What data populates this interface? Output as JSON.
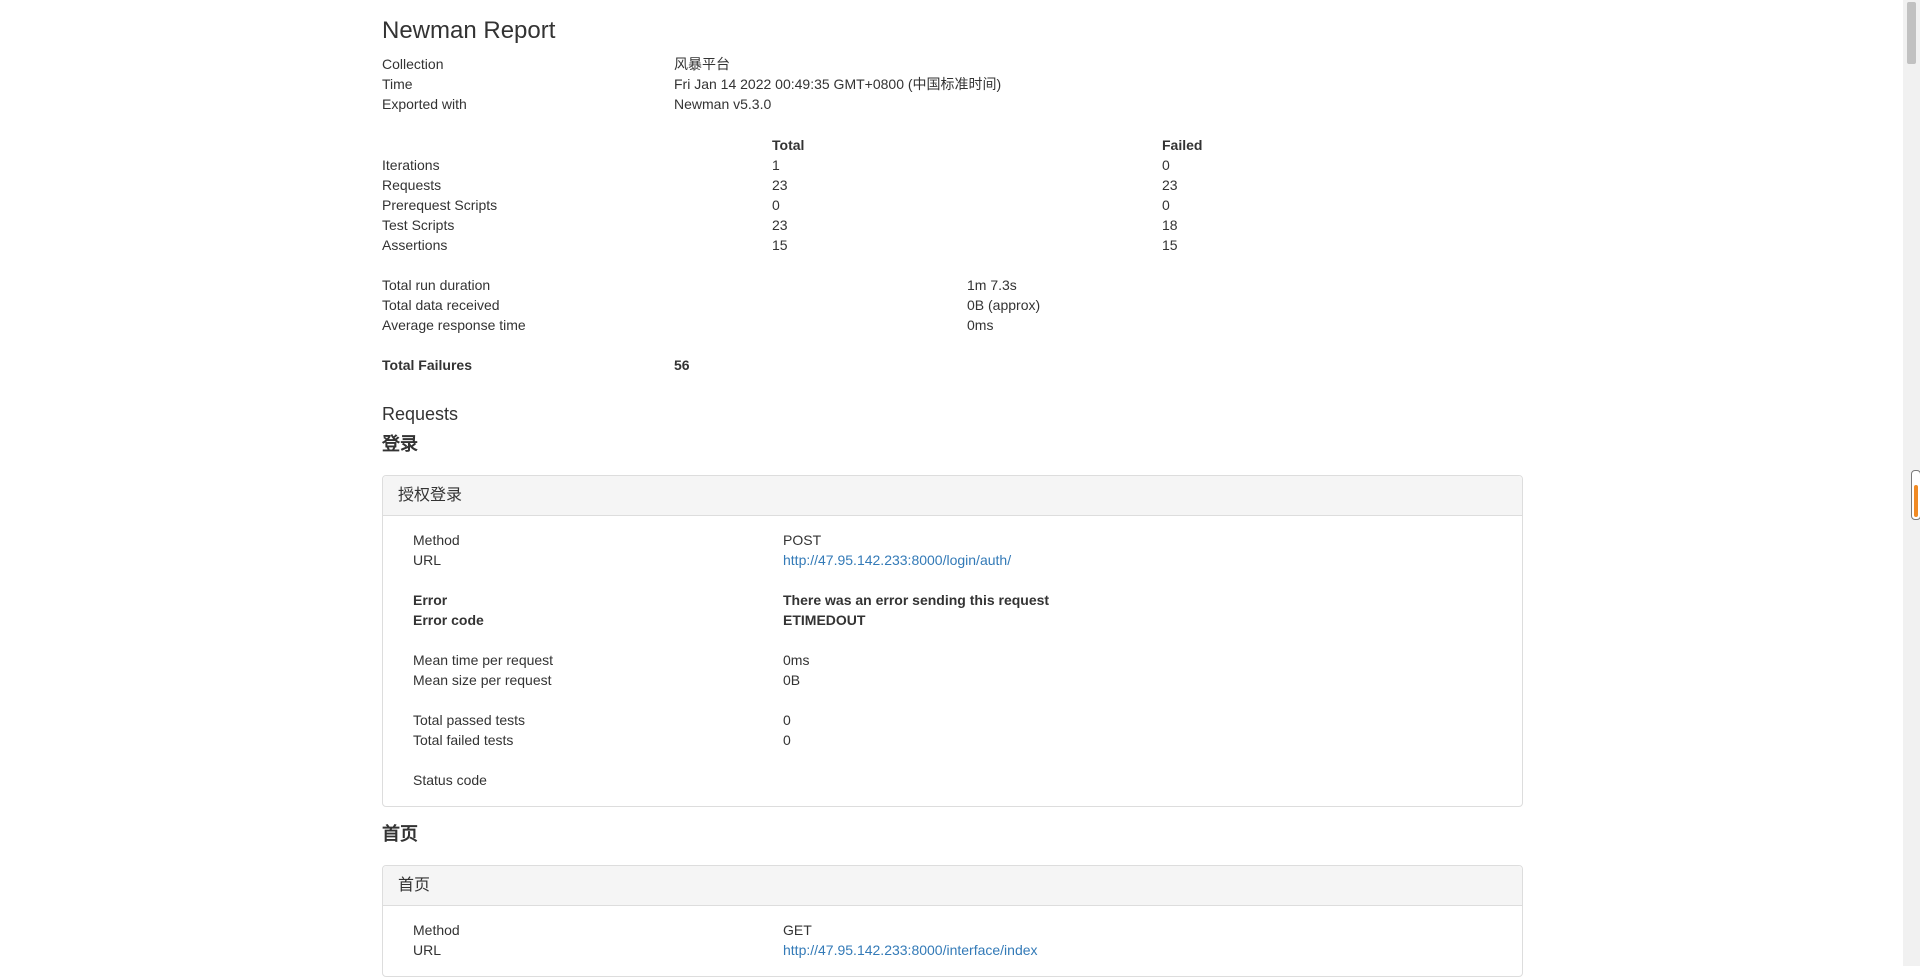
{
  "report": {
    "title": "Newman Report",
    "info": [
      {
        "label": "Collection",
        "value": "风暴平台"
      },
      {
        "label": "Time",
        "value": "Fri Jan 14 2022 00:49:35 GMT+0800 (中国标准时间)"
      },
      {
        "label": "Exported with",
        "value": "Newman v5.3.0"
      }
    ]
  },
  "stats": {
    "header_total": "Total",
    "header_failed": "Failed",
    "rows": [
      {
        "label": "Iterations",
        "total": "1",
        "failed": "0"
      },
      {
        "label": "Requests",
        "total": "23",
        "failed": "23"
      },
      {
        "label": "Prerequest Scripts",
        "total": "0",
        "failed": "0"
      },
      {
        "label": "Test Scripts",
        "total": "23",
        "failed": "18"
      },
      {
        "label": "Assertions",
        "total": "15",
        "failed": "15"
      }
    ]
  },
  "durations": [
    {
      "label": "Total run duration",
      "value": "1m 7.3s"
    },
    {
      "label": "Total data received",
      "value": "0B (approx)"
    },
    {
      "label": "Average response time",
      "value": "0ms"
    }
  ],
  "failures": {
    "label": "Total Failures",
    "value": "56"
  },
  "requests_heading": "Requests",
  "groups": [
    {
      "title": "登录",
      "panel": {
        "heading": "授权登录",
        "method_label": "Method",
        "method": "POST",
        "url_label": "URL",
        "url": "http://47.95.142.233:8000/login/auth/",
        "error_label": "Error",
        "error": "There was an error sending this request",
        "error_code_label": "Error code",
        "error_code": "ETIMEDOUT",
        "mean_time_label": "Mean time per request",
        "mean_time": "0ms",
        "mean_size_label": "Mean size per request",
        "mean_size": "0B",
        "passed_label": "Total passed tests",
        "passed": "0",
        "failed_label": "Total failed tests",
        "failed": "0",
        "status_label": "Status code",
        "status": ""
      }
    },
    {
      "title": "首页",
      "panel": {
        "heading": "首页",
        "method_label": "Method",
        "method": "GET",
        "url_label": "URL",
        "url": "http://47.95.142.233:8000/interface/index"
      }
    }
  ]
}
